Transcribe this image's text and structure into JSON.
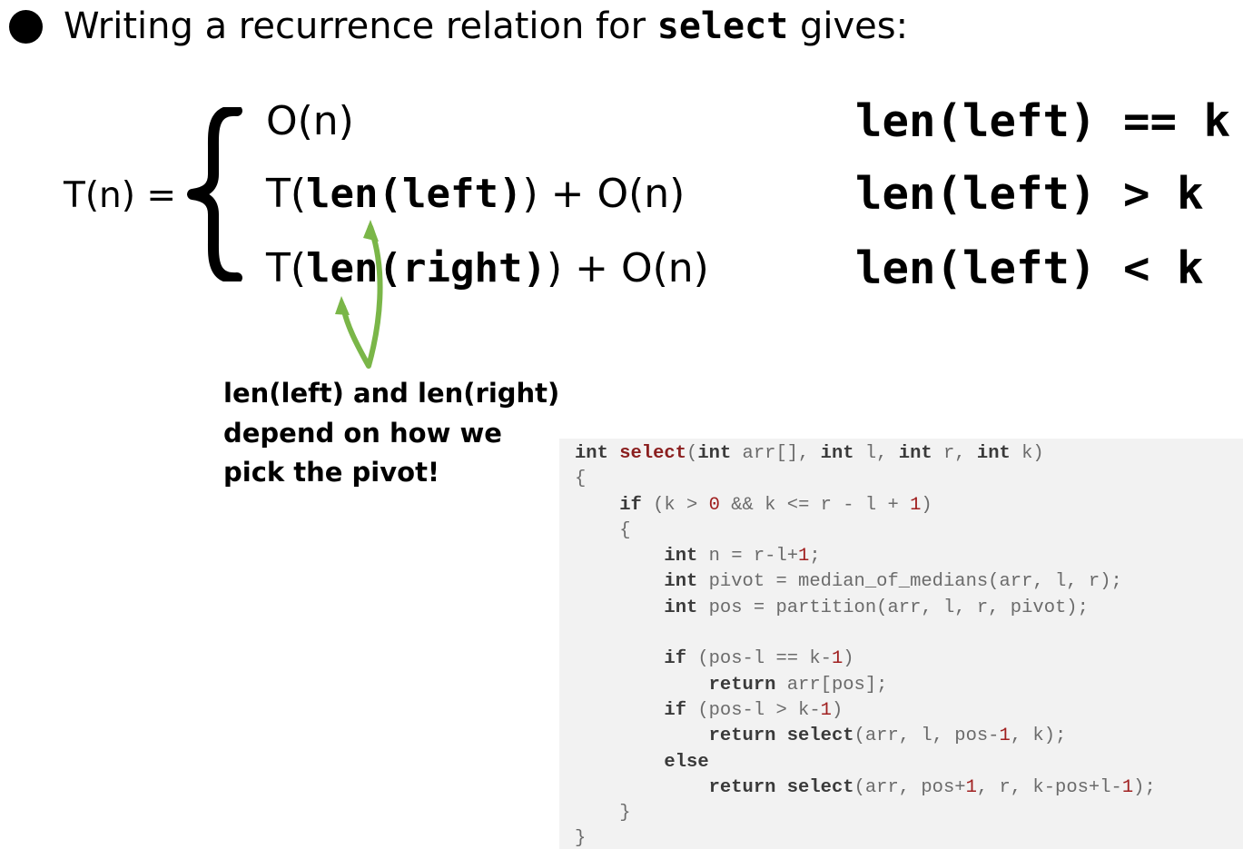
{
  "heading": {
    "prefix": "Writing a recurrence relation for ",
    "keyword": "select",
    "suffix": " gives:"
  },
  "recurrence": {
    "lhs": "T(n) =",
    "cases": [
      {
        "parts": [
          "O(n)"
        ]
      },
      {
        "parts": [
          "T(",
          "len(left)",
          ") + O(n)"
        ]
      },
      {
        "parts": [
          "T(",
          "len(right)",
          ") + O(n)"
        ]
      }
    ],
    "conditions": [
      "len(left) == k",
      "len(left) > k",
      "len(left) < k"
    ]
  },
  "annotation": {
    "lines": [
      "len(left) and len(right)",
      "depend on how we",
      "pick the pivot!"
    ],
    "arrow_color": "#7ab648"
  },
  "code": {
    "background": "#f2f2f2",
    "lines": [
      [
        [
          "k",
          "int"
        ],
        [
          "p",
          " "
        ],
        [
          "f",
          "select"
        ],
        [
          "p",
          "("
        ],
        [
          "k",
          "int"
        ],
        [
          "p",
          " arr[], "
        ],
        [
          "k",
          "int"
        ],
        [
          "p",
          " l, "
        ],
        [
          "k",
          "int"
        ],
        [
          "p",
          " r, "
        ],
        [
          "k",
          "int"
        ],
        [
          "p",
          " k)"
        ]
      ],
      [
        [
          "p",
          "{"
        ]
      ],
      [
        [
          "p",
          "    "
        ],
        [
          "k",
          "if"
        ],
        [
          "p",
          " (k > "
        ],
        [
          "n",
          "0"
        ],
        [
          "p",
          " && k <= r - l + "
        ],
        [
          "n",
          "1"
        ],
        [
          "p",
          ")"
        ]
      ],
      [
        [
          "p",
          "    {"
        ]
      ],
      [
        [
          "p",
          "        "
        ],
        [
          "k",
          "int"
        ],
        [
          "p",
          " n = r-l+"
        ],
        [
          "n",
          "1"
        ],
        [
          "p",
          ";"
        ]
      ],
      [
        [
          "p",
          "        "
        ],
        [
          "k",
          "int"
        ],
        [
          "p",
          " pivot = median_of_medians(arr, l, r);"
        ]
      ],
      [
        [
          "p",
          "        "
        ],
        [
          "k",
          "int"
        ],
        [
          "p",
          " pos = partition(arr, l, r, pivot);"
        ]
      ],
      [
        [
          "p",
          ""
        ]
      ],
      [
        [
          "p",
          "        "
        ],
        [
          "k",
          "if"
        ],
        [
          "p",
          " (pos-l == k-"
        ],
        [
          "n",
          "1"
        ],
        [
          "p",
          ")"
        ]
      ],
      [
        [
          "p",
          "            "
        ],
        [
          "k",
          "return"
        ],
        [
          "p",
          " arr[pos];"
        ]
      ],
      [
        [
          "p",
          "        "
        ],
        [
          "k",
          "if"
        ],
        [
          "p",
          " (pos-l > k-"
        ],
        [
          "n",
          "1"
        ],
        [
          "p",
          ")"
        ]
      ],
      [
        [
          "p",
          "            "
        ],
        [
          "k",
          "return"
        ],
        [
          "p",
          " "
        ],
        [
          "b",
          "select"
        ],
        [
          "p",
          "(arr, l, pos-"
        ],
        [
          "n",
          "1"
        ],
        [
          "p",
          ", k);"
        ]
      ],
      [
        [
          "p",
          "        "
        ],
        [
          "k",
          "else"
        ]
      ],
      [
        [
          "p",
          "            "
        ],
        [
          "k",
          "return"
        ],
        [
          "p",
          " "
        ],
        [
          "b",
          "select"
        ],
        [
          "p",
          "(arr, pos+"
        ],
        [
          "n",
          "1"
        ],
        [
          "p",
          ", r, k-pos+l-"
        ],
        [
          "n",
          "1"
        ],
        [
          "p",
          ");"
        ]
      ],
      [
        [
          "p",
          "    }"
        ]
      ],
      [
        [
          "p",
          "}"
        ]
      ]
    ]
  }
}
